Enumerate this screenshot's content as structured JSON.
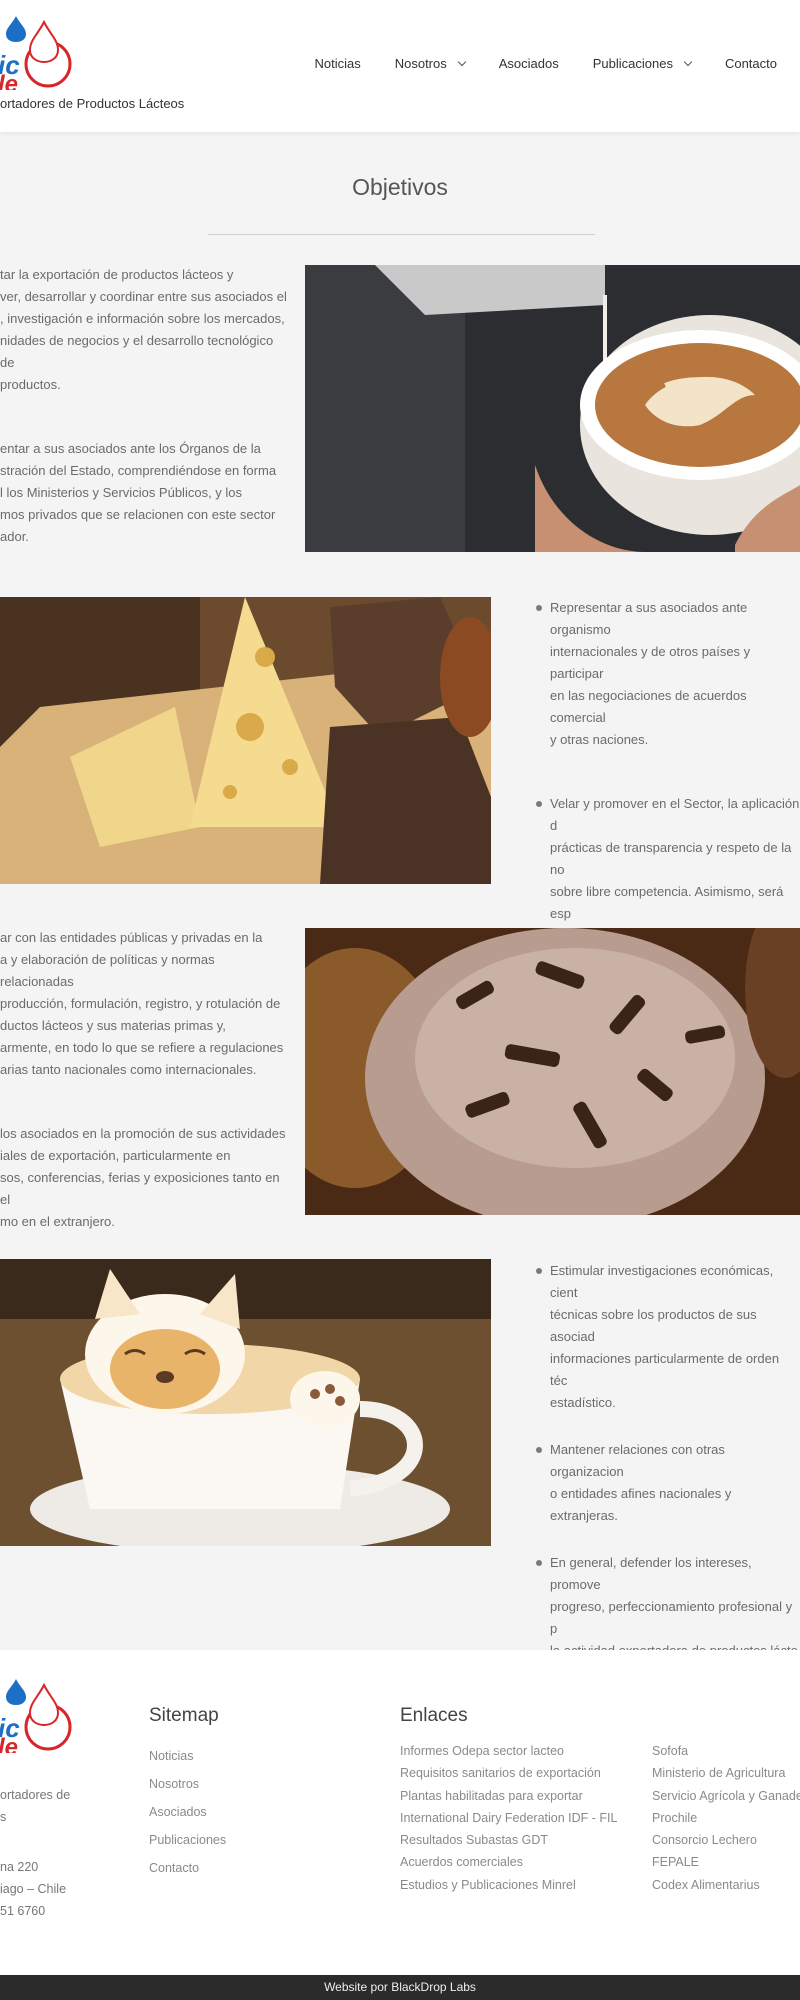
{
  "header": {
    "tagline": "ortadores de Productos Lácteos",
    "nav": [
      {
        "label": "Noticias",
        "dropdown": false
      },
      {
        "label": "Nosotros",
        "dropdown": true
      },
      {
        "label": "Asociados",
        "dropdown": false
      },
      {
        "label": "Publicaciones",
        "dropdown": true
      },
      {
        "label": "Contacto",
        "dropdown": false
      }
    ]
  },
  "colors": {
    "brand_blue": "#1c6fc4",
    "brand_red": "#d7262c"
  },
  "page": {
    "title": "Objetivos"
  },
  "rows": {
    "row1": {
      "paragraphs": [
        "tar la exportación de productos lácteos y\nver, desarrollar y coordinar entre sus asociados el\n, investigación e información sobre los mercados,\nnidades de negocios y el desarrollo tecnológico de\nproductos.",
        "entar a sus asociados ante los Órganos de la\nstración del Estado, comprendiéndose en forma\nl los Ministerios y Servicios Públicos, y los\nmos privados que se relacionen con este sector\nador."
      ],
      "image_icon": "latte-art-photo"
    },
    "row2": {
      "bullets": [
        "Representar a sus asociados ante organismo\ninternacionales y de otros países y participar\nen las negociaciones de acuerdos comercial\ny otras naciones.",
        "Velar y promover en el Sector, la aplicación d\nprácticas de transparencia y respeto de la no\nsobre libre competencia. Asimismo, será esp\npreocupación de la Asociación velar por el p\ncalificación de los productos de sus asociad\ncumplimiento de normas éticas en su produ\ncomercialización."
      ],
      "image_icon": "cheese-bread-photo"
    },
    "row3": {
      "paragraphs": [
        "ar con las entidades públicas y privadas en la\na y elaboración de políticas y normas relacionadas\nproducción, formulación, registro, y rotulación de\nductos lácteos y sus materias primas y,\narmente, en todo lo que se refiere a regulaciones\narias tanto nacionales como internacionales.",
        "los asociados en la promoción de sus actividades\niales de exportación, particularmente en\nsos, conferencias, ferias y exposiciones tanto en el\nmo en el extranjero."
      ],
      "image_icon": "chocolate-cupcake-photo"
    },
    "row4": {
      "bullets": [
        "Estimular investigaciones económicas, cient\ntécnicas sobre los productos de sus asociad\ninformaciones particularmente de orden téc\nestadístico.",
        "Mantener relaciones con otras organizacion\no entidades afines nacionales y extranjeras.",
        "En general, defender los intereses, promove\nprogreso, perfeccionamiento profesional y p\nla actividad exportadora de productos lácte\nmarco de buenas prácticas y del respeto de\ncompetencia."
      ],
      "image_icon": "dog-latte-photo"
    }
  },
  "footer": {
    "about": "ortadores de\ns",
    "address": [
      "na 220",
      "iago – Chile",
      "51 6760"
    ],
    "sitemap": {
      "title": "Sitemap",
      "items": [
        "Noticias",
        "Nosotros",
        "Asociados",
        "Publicaciones",
        "Contacto"
      ]
    },
    "links": {
      "title": "Enlaces",
      "col1": [
        "Informes Odepa sector lacteo",
        "Requisitos sanitarios de exportación",
        "Plantas habilitadas para exportar",
        "International Dairy Federation IDF - FIL",
        "Resultados Subastas GDT",
        "Acuerdos comerciales",
        "Estudios y Publicaciones Minrel"
      ],
      "col2": [
        "Sofofa",
        "Ministerio de Agricultura",
        "Servicio Agrícola y Ganade",
        "Prochile",
        "Consorcio Lechero",
        "FEPALE",
        "Codex Alimentarius"
      ]
    },
    "credits": "Website por BlackDrop Labs"
  }
}
